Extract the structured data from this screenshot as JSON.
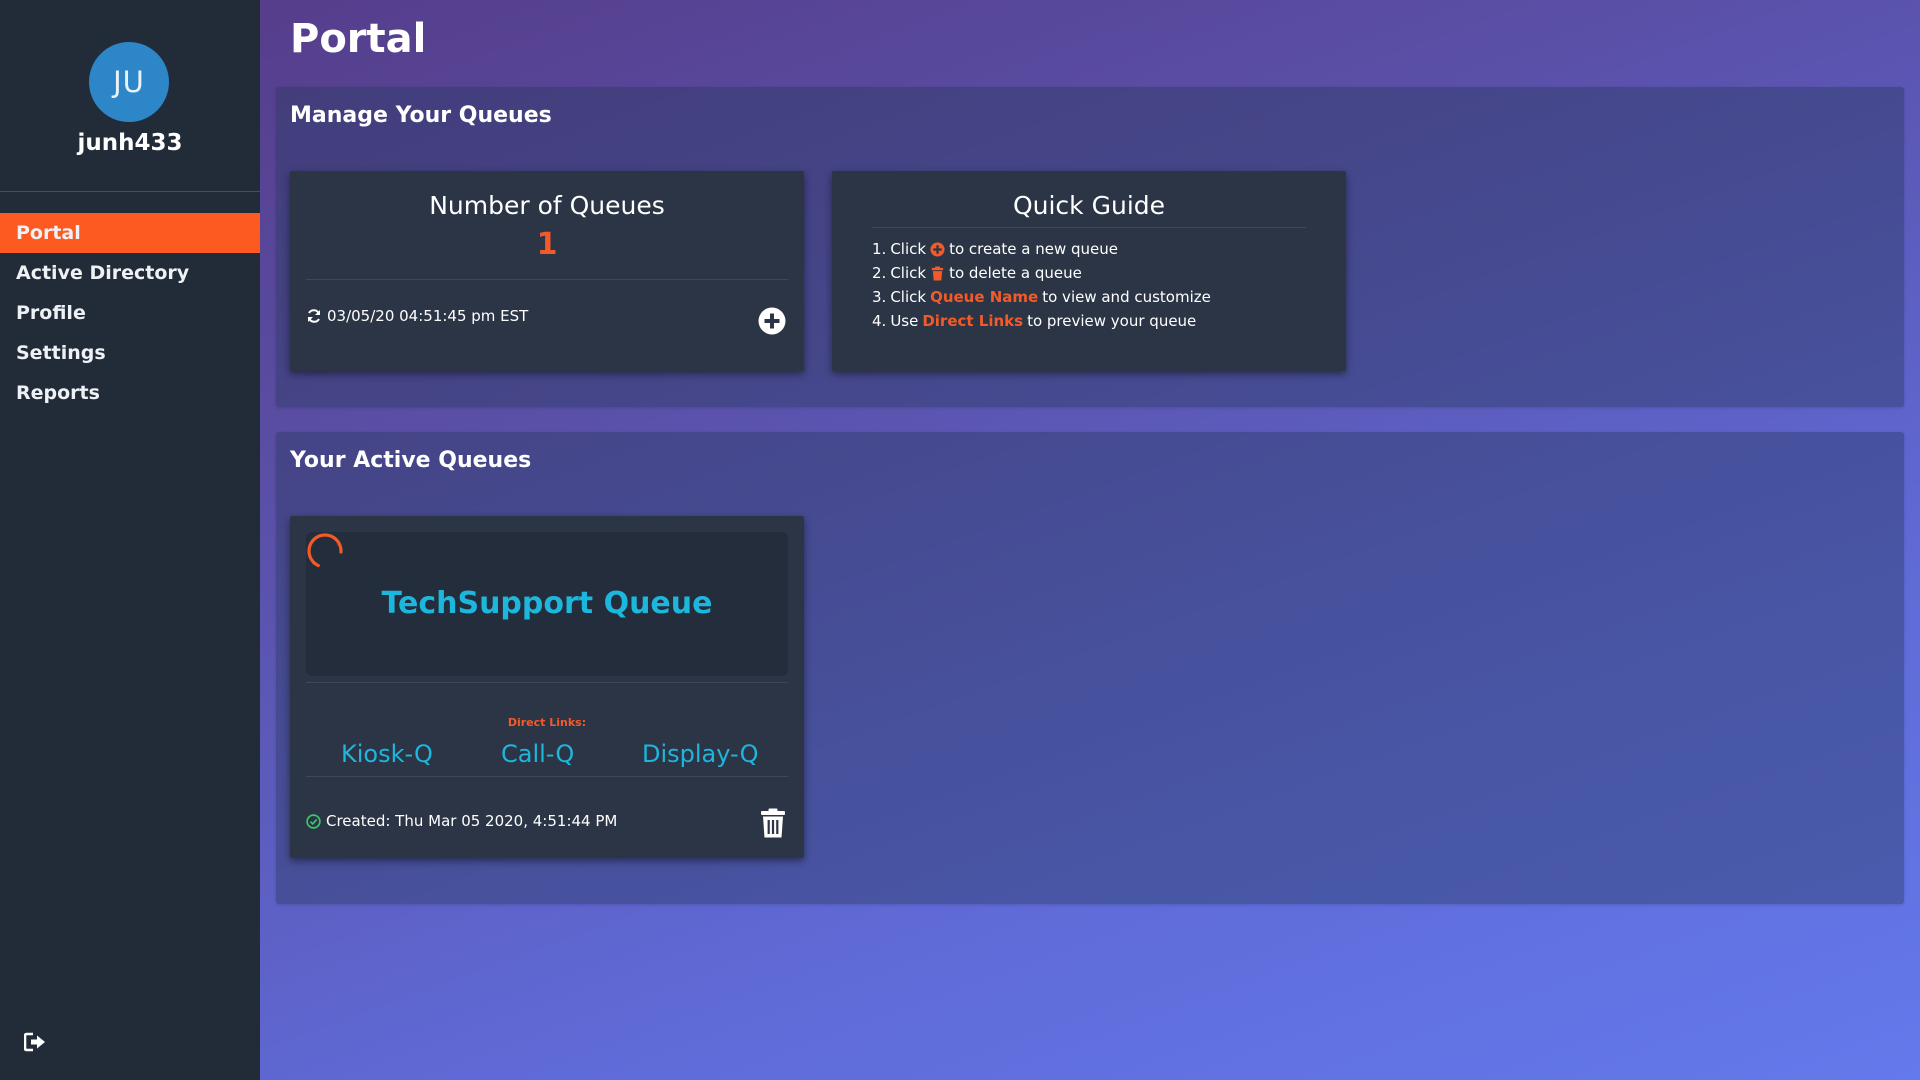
{
  "user": {
    "initials": "JU",
    "username": "junh433"
  },
  "nav": [
    {
      "label": "Portal",
      "active": true
    },
    {
      "label": "Active Directory"
    },
    {
      "label": "Profile"
    },
    {
      "label": "Settings"
    },
    {
      "label": "Reports"
    }
  ],
  "icons": {
    "logout": "logout-icon",
    "refresh": "refresh-icon",
    "add": "plus-circle-icon",
    "trash": "trash-icon",
    "spinner": "spinner-icon",
    "check": "check-circle-icon"
  },
  "colors": {
    "accent": "#fc5a21",
    "link": "#1db6dc",
    "sidebar": "#222c38",
    "card": "#2c3546"
  },
  "page": {
    "title": "Portal"
  },
  "manage": {
    "title": "Manage Your Queues",
    "count_card": {
      "heading": "Number of Queues",
      "count": "1",
      "timestamp": "03/05/20 04:51:45 pm EST"
    },
    "guide": {
      "heading": "Quick Guide",
      "steps": [
        {
          "num": "1.",
          "pre": "Click",
          "post": "to create a new queue"
        },
        {
          "num": "2.",
          "pre": "Click",
          "post": "to delete a queue"
        },
        {
          "num": "3.",
          "pre": "Click",
          "highlight": "Queue Name",
          "post": "to view and customize"
        },
        {
          "num": "4.",
          "pre": "Use",
          "highlight": "Direct Links",
          "post": "to preview your queue"
        }
      ]
    }
  },
  "active": {
    "title": "Your Active Queues",
    "queue": {
      "name": "TechSupport Queue",
      "direct_links_label": "Direct Links:",
      "links": [
        "Kiosk-Q",
        "Call-Q",
        "Display-Q"
      ],
      "created": "Created: Thu Mar 05 2020, 4:51:44 PM"
    }
  }
}
